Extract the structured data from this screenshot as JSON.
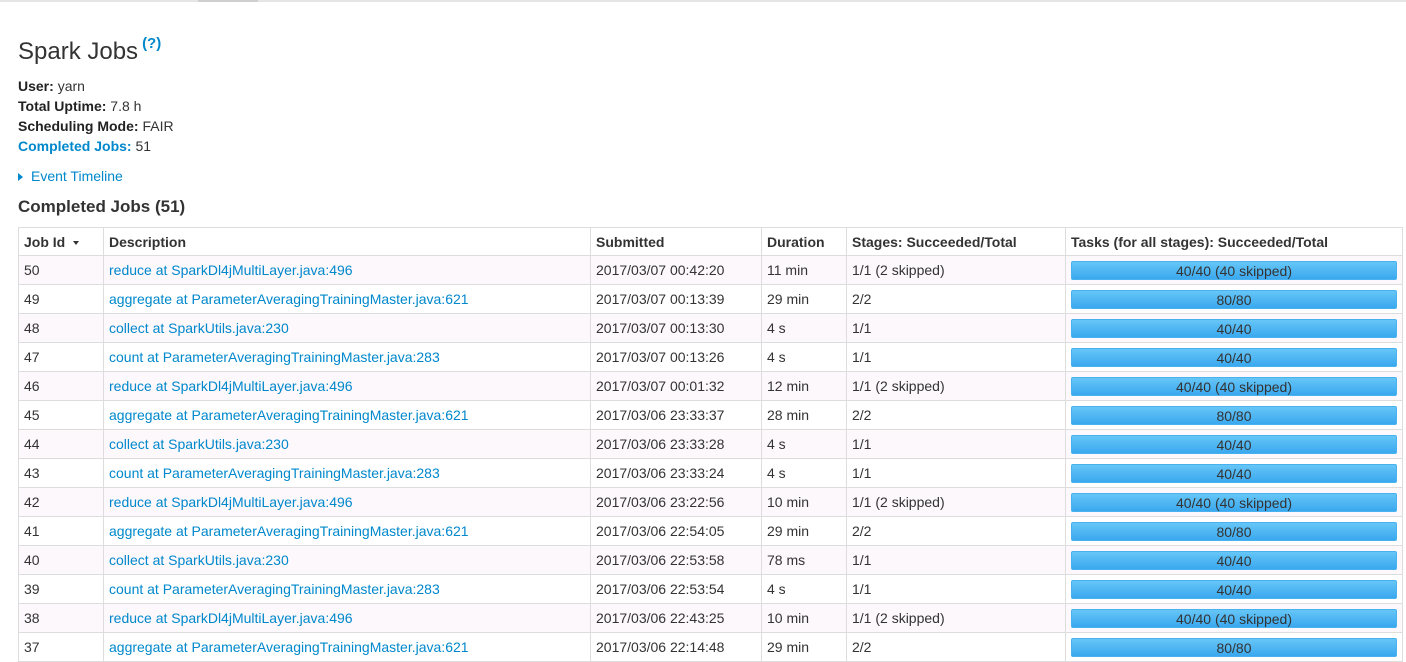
{
  "page": {
    "title": "Spark Jobs",
    "help": "(?)"
  },
  "summary": {
    "user_label": "User:",
    "user_value": "yarn",
    "uptime_label": "Total Uptime:",
    "uptime_value": "7.8 h",
    "mode_label": "Scheduling Mode:",
    "mode_value": "FAIR",
    "completed_label": "Completed Jobs:",
    "completed_value": "51"
  },
  "timeline": {
    "label": "Event Timeline"
  },
  "section": {
    "title": "Completed Jobs (51)"
  },
  "table": {
    "headers": [
      "Job Id",
      "Description",
      "Submitted",
      "Duration",
      "Stages: Succeeded/Total",
      "Tasks (for all stages): Succeeded/Total"
    ],
    "rows": [
      {
        "id": "50",
        "desc": "reduce at SparkDl4jMultiLayer.java:496",
        "submitted": "2017/03/07 00:42:20",
        "duration": "11 min",
        "stages": "1/1 (2 skipped)",
        "tasks": "40/40 (40 skipped)",
        "progress": 1.0
      },
      {
        "id": "49",
        "desc": "aggregate at ParameterAveragingTrainingMaster.java:621",
        "submitted": "2017/03/07 00:13:39",
        "duration": "29 min",
        "stages": "2/2",
        "tasks": "80/80",
        "progress": 1.0
      },
      {
        "id": "48",
        "desc": "collect at SparkUtils.java:230",
        "submitted": "2017/03/07 00:13:30",
        "duration": "4 s",
        "stages": "1/1",
        "tasks": "40/40",
        "progress": 1.0
      },
      {
        "id": "47",
        "desc": "count at ParameterAveragingTrainingMaster.java:283",
        "submitted": "2017/03/07 00:13:26",
        "duration": "4 s",
        "stages": "1/1",
        "tasks": "40/40",
        "progress": 1.0
      },
      {
        "id": "46",
        "desc": "reduce at SparkDl4jMultiLayer.java:496",
        "submitted": "2017/03/07 00:01:32",
        "duration": "12 min",
        "stages": "1/1 (2 skipped)",
        "tasks": "40/40 (40 skipped)",
        "progress": 1.0
      },
      {
        "id": "45",
        "desc": "aggregate at ParameterAveragingTrainingMaster.java:621",
        "submitted": "2017/03/06 23:33:37",
        "duration": "28 min",
        "stages": "2/2",
        "tasks": "80/80",
        "progress": 1.0
      },
      {
        "id": "44",
        "desc": "collect at SparkUtils.java:230",
        "submitted": "2017/03/06 23:33:28",
        "duration": "4 s",
        "stages": "1/1",
        "tasks": "40/40",
        "progress": 1.0
      },
      {
        "id": "43",
        "desc": "count at ParameterAveragingTrainingMaster.java:283",
        "submitted": "2017/03/06 23:33:24",
        "duration": "4 s",
        "stages": "1/1",
        "tasks": "40/40",
        "progress": 1.0
      },
      {
        "id": "42",
        "desc": "reduce at SparkDl4jMultiLayer.java:496",
        "submitted": "2017/03/06 23:22:56",
        "duration": "10 min",
        "stages": "1/1 (2 skipped)",
        "tasks": "40/40 (40 skipped)",
        "progress": 1.0
      },
      {
        "id": "41",
        "desc": "aggregate at ParameterAveragingTrainingMaster.java:621",
        "submitted": "2017/03/06 22:54:05",
        "duration": "29 min",
        "stages": "2/2",
        "tasks": "80/80",
        "progress": 1.0
      },
      {
        "id": "40",
        "desc": "collect at SparkUtils.java:230",
        "submitted": "2017/03/06 22:53:58",
        "duration": "78 ms",
        "stages": "1/1",
        "tasks": "40/40",
        "progress": 1.0
      },
      {
        "id": "39",
        "desc": "count at ParameterAveragingTrainingMaster.java:283",
        "submitted": "2017/03/06 22:53:54",
        "duration": "4 s",
        "stages": "1/1",
        "tasks": "40/40",
        "progress": 1.0
      },
      {
        "id": "38",
        "desc": "reduce at SparkDl4jMultiLayer.java:496",
        "submitted": "2017/03/06 22:43:25",
        "duration": "10 min",
        "stages": "1/1 (2 skipped)",
        "tasks": "40/40 (40 skipped)",
        "progress": 1.0
      },
      {
        "id": "37",
        "desc": "aggregate at ParameterAveragingTrainingMaster.java:621",
        "submitted": "2017/03/06 22:14:48",
        "duration": "29 min",
        "stages": "2/2",
        "tasks": "80/80",
        "progress": 1.0
      }
    ]
  },
  "colors": {
    "link": "#0088cc",
    "progress_fill": "#3aa8ef",
    "row_odd": "#fdf8fb"
  },
  "icons": {
    "sort": "sort-descending-icon",
    "expand": "caret-right-icon"
  }
}
